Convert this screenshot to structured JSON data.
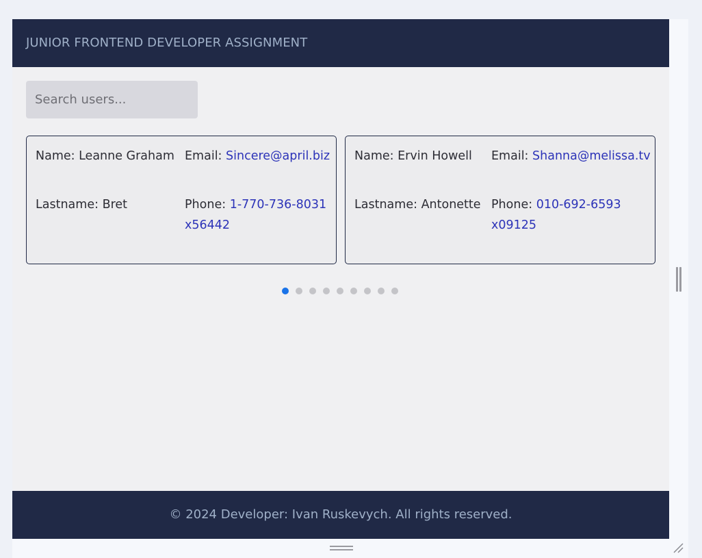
{
  "header": {
    "title": "JUNIOR FRONTEND DEVELOPER ASSIGNMENT"
  },
  "search": {
    "placeholder": "Search users...",
    "value": ""
  },
  "users": [
    {
      "name_label": "Name:",
      "name": "Leanne Graham",
      "lastname_label": "Lastname:",
      "lastname": "Bret",
      "email_label": "Email:",
      "email": "Sincere@april.biz",
      "phone_label": "Phone:",
      "phone": "1-770-736-8031 x56442"
    },
    {
      "name_label": "Name:",
      "name": "Ervin Howell",
      "lastname_label": "Lastname:",
      "lastname": "Antonette",
      "email_label": "Email:",
      "email": "Shanna@melissa.tv",
      "phone_label": "Phone:",
      "phone": "010-692-6593 x09125"
    }
  ],
  "carousel": {
    "total_pages": 9,
    "active_page": 1
  },
  "footer": {
    "text": "© 2024 Developer: Ivan Ruskevych. All rights reserved."
  },
  "colors": {
    "header_bg": "#202946",
    "header_text": "#9fb0c8",
    "link": "#2c33b8",
    "active_dot": "#1a73e8",
    "inactive_dot": "#c4c4c8"
  }
}
